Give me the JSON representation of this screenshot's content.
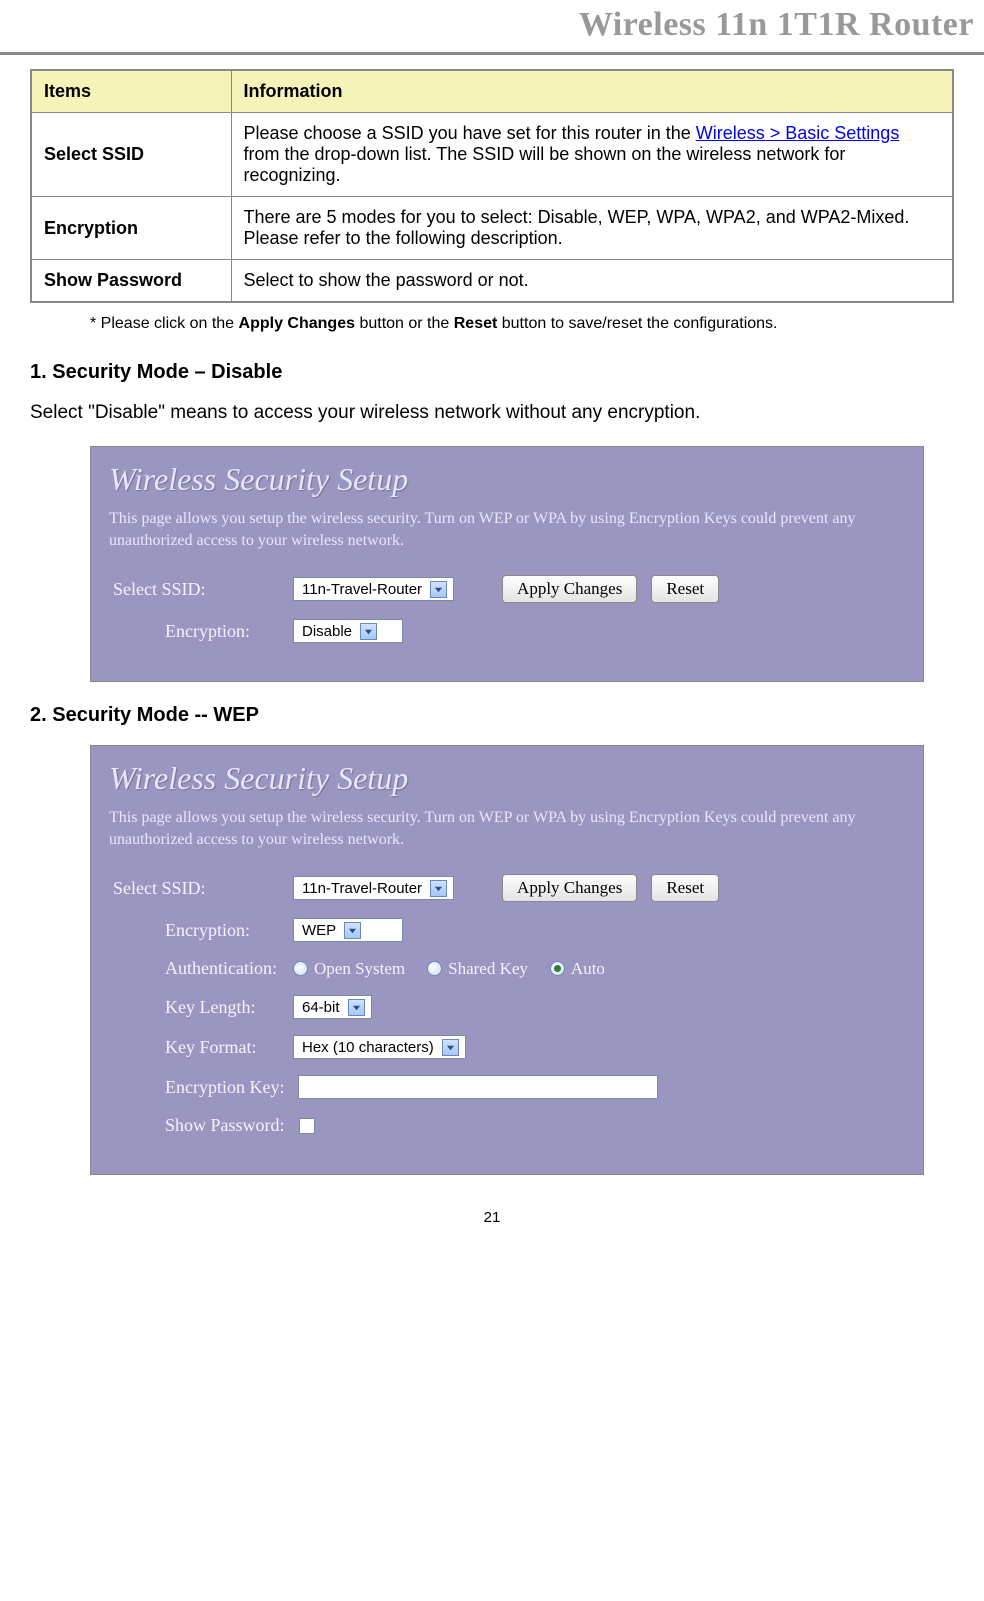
{
  "header": {
    "title": "Wireless 11n 1T1R Router"
  },
  "table": {
    "head": {
      "items": "Items",
      "info": "Information"
    },
    "rows": [
      {
        "item": "Select SSID",
        "info_pre": "Please choose a SSID you have set for this router in the ",
        "info_link": "Wireless > Basic Settings",
        "info_post": " from the drop-down list. The SSID will be shown on the wireless network for recognizing."
      },
      {
        "item": "Encryption",
        "info": "There are 5 modes for you to select: Disable, WEP, WPA, WPA2, and WPA2-Mixed. Please refer to the following description."
      },
      {
        "item": "Show Password",
        "info": "Select to show the password or not."
      }
    ]
  },
  "note": {
    "pre": "* Please click on the ",
    "b1": "Apply Changes",
    "mid": " button or the ",
    "b2": "Reset",
    "post": " button to save/reset the configurations."
  },
  "sections": {
    "s1": {
      "heading": "1.   Security Mode – Disable",
      "text": "Select \"Disable\" means to access your wireless network without any encryption."
    },
    "s2": {
      "heading": "2.   Security Mode -- WEP"
    }
  },
  "panelCommon": {
    "title": "Wireless Security Setup",
    "desc": "This page allows you setup the wireless security. Turn on WEP or WPA by using Encryption Keys could prevent any unauthorized access to your wireless network.",
    "selectSsidLabel": "Select SSID:",
    "ssidValue": "11n-Travel-Router",
    "applyBtn": "Apply Changes",
    "resetBtn": "Reset",
    "encryptionLabel": "Encryption:"
  },
  "panel1": {
    "encryptionValue": "Disable"
  },
  "panel2": {
    "encryptionValue": "WEP",
    "authLabel": "Authentication:",
    "authOptions": {
      "open": "Open System",
      "shared": "Shared Key",
      "auto": "Auto"
    },
    "keyLengthLabel": "Key Length:",
    "keyLengthValue": "64-bit",
    "keyFormatLabel": "Key Format:",
    "keyFormatValue": "Hex (10 characters)",
    "encKeyLabel": "Encryption Key:",
    "showPassLabel": "Show Password:"
  },
  "pageNumber": "21"
}
